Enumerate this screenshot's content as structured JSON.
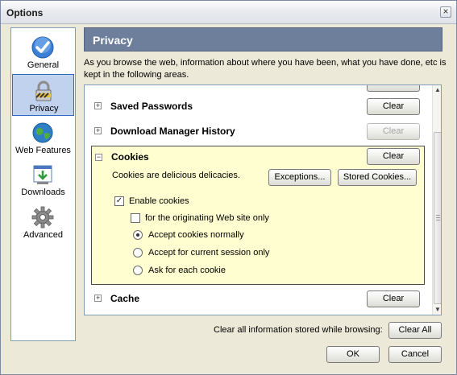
{
  "window": {
    "title": "Options",
    "close_glyph": "×"
  },
  "sidebar": {
    "items": [
      {
        "label": "General",
        "icon": "checkmark-icon",
        "selected": false
      },
      {
        "label": "Privacy",
        "icon": "padlock-icon",
        "selected": true
      },
      {
        "label": "Web Features",
        "icon": "globe-icon",
        "selected": false
      },
      {
        "label": "Downloads",
        "icon": "download-icon",
        "selected": false
      },
      {
        "label": "Advanced",
        "icon": "gear-icon",
        "selected": false
      }
    ]
  },
  "page": {
    "title": "Privacy",
    "description": "As you browse the web, information about where you have been, what you have done, etc is kept in the following areas."
  },
  "sections": {
    "saved_passwords": {
      "title": "Saved Passwords",
      "clear_label": "Clear",
      "expanded": false
    },
    "download_history": {
      "title": "Download Manager History",
      "clear_label": "Clear",
      "clear_enabled": false,
      "expanded": false
    },
    "cookies": {
      "title": "Cookies",
      "clear_label": "Clear",
      "expanded": true,
      "description": "Cookies are delicious delicacies.",
      "exceptions_label": "Exceptions...",
      "stored_label": "Stored Cookies...",
      "enable_label": "Enable cookies",
      "enable_checked": true,
      "originating_label": "for the originating Web site only",
      "originating_checked": false,
      "radio_options": [
        {
          "label": "Accept cookies normally",
          "selected": true
        },
        {
          "label": "Accept for current session only",
          "selected": false
        },
        {
          "label": "Ask for each cookie",
          "selected": false
        }
      ]
    },
    "cache": {
      "title": "Cache",
      "clear_label": "Clear",
      "expanded": false
    }
  },
  "toggle_glyphs": {
    "expand": "+",
    "collapse": "−"
  },
  "footer": {
    "clear_all_text": "Clear all information stored while browsing:",
    "clear_all_label": "Clear All",
    "ok_label": "OK",
    "cancel_label": "Cancel"
  },
  "colors": {
    "header_bg": "#6d7f9b",
    "cookies_bg": "#fffed0",
    "selected_nav": "#c1d2ee"
  }
}
